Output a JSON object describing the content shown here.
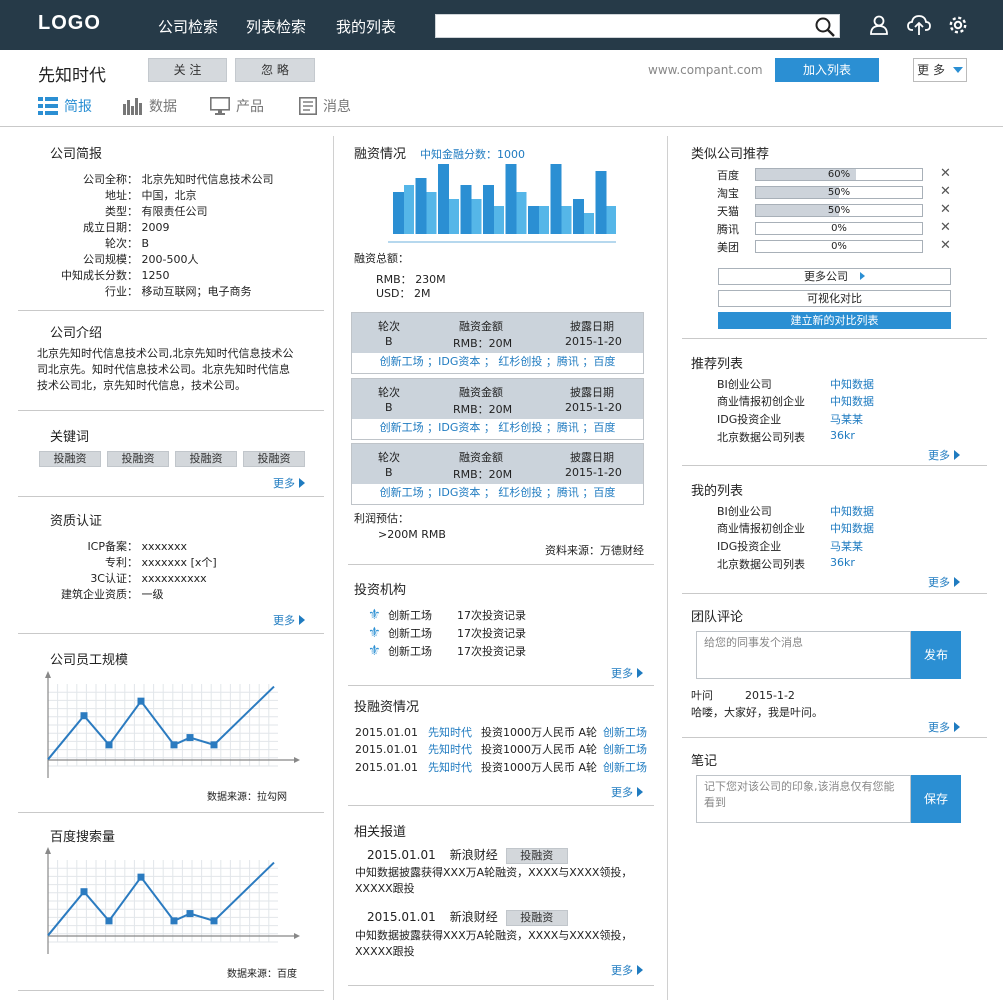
{
  "nav": {
    "logo": "LOGO",
    "links": [
      "公司检索",
      "列表检索",
      "我的列表"
    ],
    "search_placeholder": "",
    "icons": [
      "search-icon",
      "user-icon",
      "upload-icon",
      "gear-icon"
    ]
  },
  "header": {
    "company_name": "先知时代",
    "follow_label": "关 注",
    "ignore_label": "忽 略",
    "url": "www.compant.com",
    "add_list_label": "加入列表",
    "more_label": "更 多"
  },
  "tabs": [
    {
      "label": "简报",
      "icon": "list-icon",
      "active": true
    },
    {
      "label": "数据",
      "icon": "bar-chart-icon",
      "active": false
    },
    {
      "label": "产品",
      "icon": "monitor-icon",
      "active": false
    },
    {
      "label": "消息",
      "icon": "document-icon",
      "active": false
    }
  ],
  "brief": {
    "title": "公司简报",
    "fields": [
      {
        "k": "公司全称：",
        "v": "北京先知时代信息技术公司"
      },
      {
        "k": "地址：",
        "v": "中国，北京"
      },
      {
        "k": "类型：",
        "v": "有限责任公司"
      },
      {
        "k": "成立日期：",
        "v": "2009"
      },
      {
        "k": "轮次：",
        "v": "B"
      },
      {
        "k": "公司规模：",
        "v": "200-500人"
      },
      {
        "k": "中知成长分数：",
        "v": "1250"
      },
      {
        "k": "行业：",
        "v": "移动互联网；电子商务"
      }
    ]
  },
  "intro": {
    "title": "公司介绍",
    "text": "北京先知时代信息技术公司,北京先知时代信息技术公司北京先。知时代信息技术公司。北京先知时代信息技术公司北，京先知时代信息，技术公司。"
  },
  "keywords": {
    "title": "关键词",
    "items": [
      "投融资",
      "投融资",
      "投融资",
      "投融资"
    ],
    "more": "更多"
  },
  "qualification": {
    "title": "资质认证",
    "fields": [
      {
        "k": "ICP备案：",
        "v": "xxxxxxx"
      },
      {
        "k": "专利：",
        "v": "xxxxxxx [x个]"
      },
      {
        "k": "3C认证：",
        "v": "xxxxxxxxxx"
      },
      {
        "k": "建筑企业资质：",
        "v": "一级"
      }
    ],
    "more": "更多"
  },
  "employees": {
    "title": "公司员工规模",
    "source": "数据来源：拉勾网"
  },
  "baidu": {
    "title": "百度搜索量",
    "source": "数据来源：百度"
  },
  "chart_data": [
    {
      "type": "bar",
      "title": "融资情况",
      "note": "中知金融分数：1000",
      "series": [
        {
          "values": [
            6,
            8,
            10,
            7,
            7,
            10,
            4,
            10,
            5,
            9
          ]
        },
        {
          "values": [
            7,
            6,
            5,
            5,
            4,
            6,
            4,
            4,
            3,
            4
          ]
        }
      ]
    },
    {
      "type": "line",
      "title": "公司员工规模",
      "values": [
        1,
        4,
        2,
        5,
        2,
        2.5,
        2,
        6
      ],
      "source": "数据来源：拉勾网"
    },
    {
      "type": "line",
      "title": "百度搜索量",
      "values": [
        1,
        4,
        2,
        5,
        2,
        2.5,
        2,
        6
      ],
      "source": "数据来源：百度"
    }
  ],
  "financing": {
    "title": "融资情况",
    "score": "中知金融分数：1000",
    "total_label": "融资总额：",
    "rmb_label": "RMB：",
    "rmb_value": "230M",
    "usd_label": "USD：",
    "usd_value": "2M",
    "col_round": "轮次",
    "col_amount": "融资金额",
    "col_date": "披露日期",
    "rounds": [
      {
        "round": "B",
        "amount": "RMB：20M",
        "date": "2015-1-20",
        "investors": "创新工场 ；IDG资本 ； 红杉创投 ；腾讯 ；百度"
      },
      {
        "round": "B",
        "amount": "RMB：20M",
        "date": "2015-1-20",
        "investors": "创新工场 ；IDG资本 ； 红杉创投 ；腾讯 ；百度"
      },
      {
        "round": "B",
        "amount": "RMB：20M",
        "date": "2015-1-20",
        "investors": "创新工场 ；IDG资本 ； 红杉创投 ；腾讯 ；百度"
      }
    ],
    "profit_label": "利润预估：",
    "profit_value": ">200M RMB",
    "source": "资料来源：万德财经"
  },
  "investors": {
    "title": "投资机构",
    "items": [
      {
        "name": "创新工场",
        "count": "17次投资记录"
      },
      {
        "name": "创新工场",
        "count": "17次投资记录"
      },
      {
        "name": "创新工场",
        "count": "17次投资记录"
      }
    ],
    "more": "更多"
  },
  "invest_events": {
    "title": "投融资情况",
    "items": [
      {
        "date": "2015.01.01",
        "company": "先知时代",
        "desc": "投资1000万人民币 A轮",
        "investor": "创新工场"
      },
      {
        "date": "2015.01.01",
        "company": "先知时代",
        "desc": "投资1000万人民币 A轮",
        "investor": "创新工场"
      },
      {
        "date": "2015.01.01",
        "company": "先知时代",
        "desc": "投资1000万人民币 A轮",
        "investor": "创新工场"
      }
    ],
    "more": "更多"
  },
  "news": {
    "title": "相关报道",
    "items": [
      {
        "date": "2015.01.01",
        "source": "新浪财经",
        "tag": "投融资",
        "text1": "中知数据披露获得XXX万A轮融资，XXXX与XXXX领投，",
        "text2": "XXXXX跟投"
      },
      {
        "date": "2015.01.01",
        "source": "新浪财经",
        "tag": "投融资",
        "text1": "中知数据披露获得XXX万A轮融资，XXXX与XXXX领投，",
        "text2": "XXXXX跟投"
      }
    ],
    "more": "更多"
  },
  "similar": {
    "title": "类似公司推荐",
    "items": [
      {
        "name": "百度",
        "value": "60%",
        "fraction": 0.6
      },
      {
        "name": "淘宝",
        "value": "50%",
        "fraction": 0.5
      },
      {
        "name": "天猫",
        "value": "50%",
        "fraction": 0.5
      },
      {
        "name": "腾讯",
        "value": "0%",
        "fraction": 0
      },
      {
        "name": "美团",
        "value": "0%",
        "fraction": 0
      }
    ],
    "more_companies": "更多公司",
    "visual_compare": "可视化对比",
    "new_compare": "建立新的对比列表"
  },
  "recommend": {
    "title": "推荐列表",
    "items": [
      {
        "name": "BI创业公司",
        "owner": "中知数据"
      },
      {
        "name": "商业情报初创企业",
        "owner": "中知数据"
      },
      {
        "name": "IDG投资企业",
        "owner": "马某某"
      },
      {
        "name": "北京数据公司列表",
        "owner": "36kr"
      }
    ],
    "more": "更多"
  },
  "mylist": {
    "title": "我的列表",
    "items": [
      {
        "name": "BI创业公司",
        "owner": "中知数据"
      },
      {
        "name": "商业情报初创企业",
        "owner": "中知数据"
      },
      {
        "name": "IDG投资企业",
        "owner": "马某某"
      },
      {
        "name": "北京数据公司列表",
        "owner": "36kr"
      }
    ],
    "more": "更多"
  },
  "comments": {
    "title": "团队评论",
    "placeholder": "给您的同事发个消息",
    "send_label": "发布",
    "author": "叶问",
    "date": "2015-1-2",
    "text": "哈喽，大家好，我是叶问。",
    "more": "更多"
  },
  "notes": {
    "title": "笔记",
    "placeholder": "记下您对该公司的印象,该消息仅有您能看到",
    "save_label": "保存"
  },
  "colors": {
    "topbar": "#263a48",
    "accent": "#2b8fd3",
    "link": "#1f7bc0"
  }
}
